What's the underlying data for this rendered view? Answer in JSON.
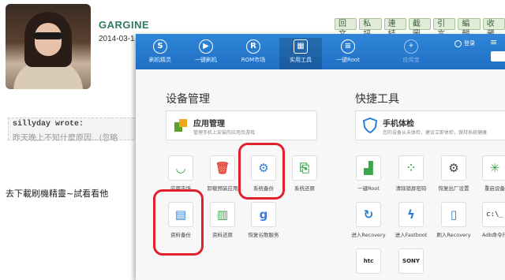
{
  "post": {
    "username": "GARGINE",
    "date": "2014-03-1",
    "actions": [
      "回文",
      "私訊",
      "連結",
      "截圖",
      "引言",
      "編輯",
      "收藏"
    ],
    "quote_author": "sillyday wrote:",
    "quote_text": "昨天晚上不知什麼原因...(忽略",
    "body": "去下載刷機精靈~試看看他"
  },
  "nav": [
    "刷机精灵",
    "一键刷机",
    "ROM市场",
    "实用工具",
    "一键Root",
    "应用宝"
  ],
  "nav_login": "登录",
  "sections": {
    "device": "设备管理",
    "quick": "快捷工具"
  },
  "cards": {
    "app": {
      "title": "应用管理",
      "sub": "管理手机上安装的应用及游戏"
    },
    "check": {
      "title": "手机体检",
      "sub": "您的设备从未体检，建议立即体检，保持系统健康"
    }
  },
  "device_tools": [
    "应用市场",
    "卸载预装应用",
    "系统备份",
    "系统还原",
    "资料备份",
    "资料还原",
    "恢复谷歌服务"
  ],
  "quick_tools": [
    "一键Root",
    "清除锁屏密码",
    "恢复出厂设置",
    "重启设备",
    "进入Recovery",
    "进入Fastboot",
    "刷入Recovery",
    "Adb命令行",
    "htc",
    "SONY"
  ],
  "colors": {
    "nav_blue": "#2a7fd4",
    "highlight_red": "#e0202b",
    "forum_green": "#2e7d5b"
  }
}
